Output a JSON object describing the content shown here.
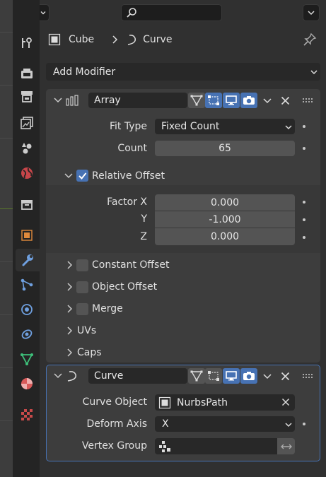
{
  "search": {
    "placeholder": ""
  },
  "breadcrumb": {
    "object": "Cube",
    "data": "Curve"
  },
  "add_modifier": {
    "label": "Add Modifier"
  },
  "array_modifier": {
    "name": "Array",
    "fit_type_label": "Fit Type",
    "fit_type_value": "Fixed Count",
    "count_label": "Count",
    "count_value": "65",
    "relative_offset_label": "Relative Offset",
    "factor_x_label": "Factor X",
    "factor_x_value": "0.000",
    "y_label": "Y",
    "y_value": "-1.000",
    "z_label": "Z",
    "z_value": "0.000",
    "constant_offset_label": "Constant Offset",
    "object_offset_label": "Object Offset",
    "merge_label": "Merge",
    "uvs_label": "UVs",
    "caps_label": "Caps"
  },
  "curve_modifier": {
    "name": "Curve",
    "curve_object_label": "Curve Object",
    "curve_object_value": "NurbsPath",
    "deform_axis_label": "Deform Axis",
    "deform_axis_value": "X",
    "vertex_group_label": "Vertex Group",
    "vertex_group_value": ""
  },
  "colors": {
    "accent": "#4772b3",
    "panel": "#3d3d3d",
    "field": "#545454",
    "background": "#303030"
  }
}
